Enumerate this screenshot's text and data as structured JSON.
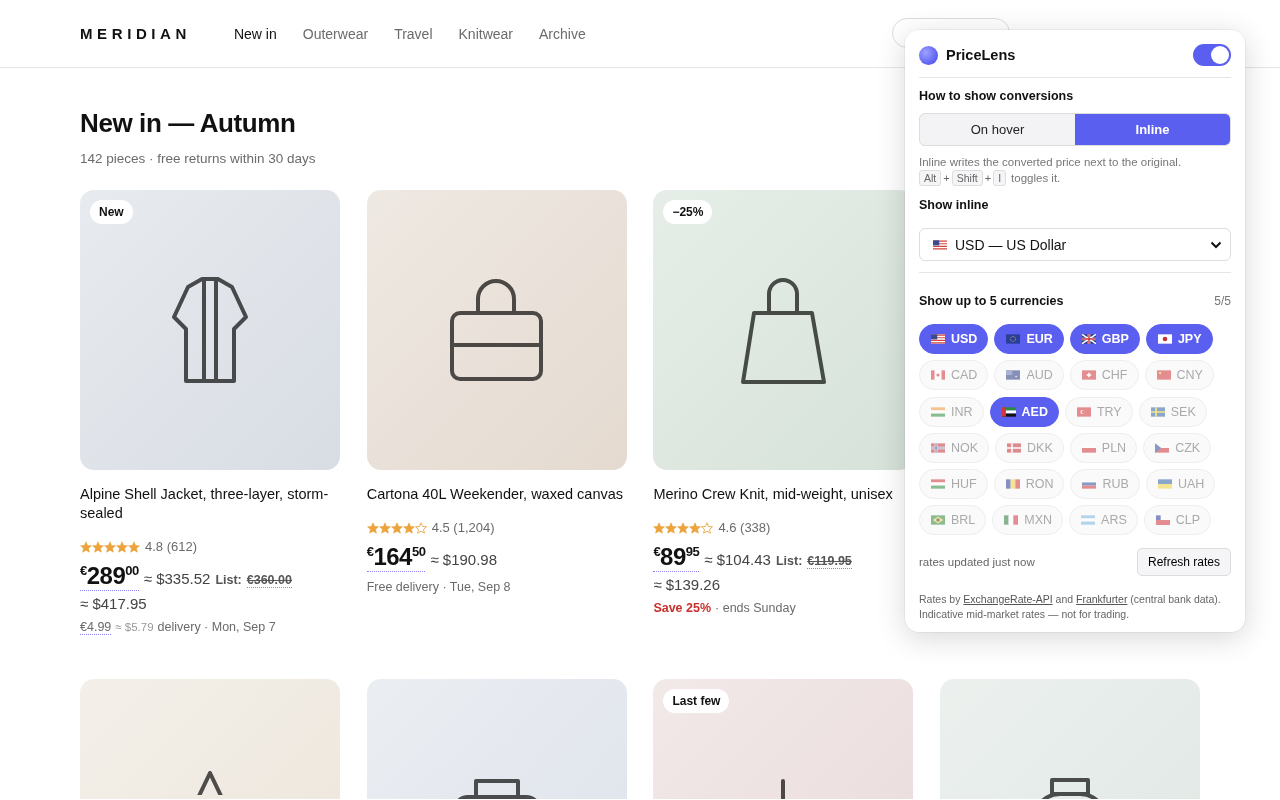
{
  "header": {
    "logo": "MERIDIAN",
    "nav": [
      {
        "label": "New in",
        "selected": true
      },
      {
        "label": "Outerwear",
        "selected": false
      },
      {
        "label": "Travel",
        "selected": false
      },
      {
        "label": "Knitwear",
        "selected": false
      },
      {
        "label": "Archive",
        "selected": false
      }
    ]
  },
  "page": {
    "title": "New in — Autumn",
    "subtitle": "142 pieces · free returns within 30 days"
  },
  "rows": [
    {
      "products": [
        {
          "badge": "New",
          "image": {
            "kind": "jacket",
            "color": "#d8dde4"
          },
          "name": "Alpine Shell Jacket, three-layer, storm-sealed",
          "stars": 5,
          "rating": "4.8 (612)",
          "price": "$^{€}$289$^{00}$",
          "converted": "≈ $335.52",
          "list_label": "List:",
          "list_price": "€360.00",
          "list_converted": "≈ $417.95",
          "note": [
            {
              "kind": "price",
              "text": "€4.99"
            },
            {
              "kind": "converted",
              "text": "≈ $5.79"
            },
            {
              "kind": "text",
              "text": "delivery · Mon, Sep 7"
            }
          ]
        },
        {
          "image": {
            "kind": "briefcase",
            "color": "#e4dad0"
          },
          "name": "Cartona 40L Weekender, waxed canvas",
          "stars": 4,
          "rating": "4.5 (1,204)",
          "price": "$^{€}$164$^{50}$",
          "converted": "≈ $190.98",
          "note": [
            {
              "kind": "text",
              "text": "Free delivery · Tue, Sep 8"
            }
          ]
        },
        {
          "badge": "−25%",
          "image": {
            "kind": "tote",
            "color": "#d6e2d9"
          },
          "name": "Merino Crew Knit, mid-weight, unisex",
          "stars": 4,
          "rating": "4.6 (338)",
          "price": "$^{€}$89$^{95}$",
          "converted": "≈ $104.43",
          "list_label": "List:",
          "list_price": "€119.95",
          "list_converted": "≈ $139.26",
          "note": [
            {
              "kind": "alert",
              "text": "Save 25%"
            },
            {
              "kind": "text",
              "text": "· ends Sunday"
            }
          ]
        }
      ]
    },
    {
      "products": [
        {
          "image": {
            "kind": "tent",
            "color": "#ece5da"
          }
        },
        {
          "image": {
            "kind": "bag",
            "color": "#dde2ea"
          }
        },
        {
          "badge": "Last few",
          "image": {
            "kind": "pole",
            "color": "#e9dada"
          }
        },
        {
          "image": {
            "kind": "jar",
            "color": "#dfe7e3"
          }
        }
      ]
    }
  ],
  "extension": {
    "name": "PriceLens",
    "enabled": true,
    "mode_label": "How to show conversions",
    "modes": [
      {
        "label": "On hover",
        "selected": false
      },
      {
        "label": "Inline",
        "selected": true
      }
    ],
    "help": "Inline writes the converted price next to the original.",
    "shortcut": [
      {
        "kind": "key",
        "text": "Alt"
      },
      {
        "kind": "plus",
        "text": "+"
      },
      {
        "kind": "key",
        "text": "Shift"
      },
      {
        "kind": "plus",
        "text": "+"
      },
      {
        "kind": "key",
        "text": "I"
      }
    ],
    "shortcut_note": "toggles it.",
    "inline_label": "Show inline",
    "inline_currency": {
      "kind": "us",
      "value": "USD — US Dollar"
    },
    "currencies_label": "Show up to 5 currencies",
    "currencies_count": "5/5",
    "currencies": [
      {
        "code": "USD",
        "kind": "us",
        "selected": true
      },
      {
        "code": "EUR",
        "kind": "eu",
        "selected": true
      },
      {
        "code": "GBP",
        "kind": "gb",
        "selected": true
      },
      {
        "code": "JPY",
        "kind": "jp",
        "selected": true
      },
      {
        "code": "CAD",
        "kind": "ca",
        "selected": false
      },
      {
        "code": "AUD",
        "kind": "au",
        "selected": false
      },
      {
        "code": "CHF",
        "kind": "ch",
        "selected": false
      },
      {
        "code": "CNY",
        "kind": "cn",
        "selected": false
      },
      {
        "code": "INR",
        "kind": "in",
        "selected": false
      },
      {
        "code": "AED",
        "kind": "ae",
        "selected": true
      },
      {
        "code": "TRY",
        "kind": "tr",
        "selected": false
      },
      {
        "code": "SEK",
        "kind": "se",
        "selected": false
      },
      {
        "code": "NOK",
        "kind": "no",
        "selected": false
      },
      {
        "code": "DKK",
        "kind": "dk",
        "selected": false
      },
      {
        "code": "PLN",
        "kind": "pl",
        "selected": false
      },
      {
        "code": "CZK",
        "kind": "cz",
        "selected": false
      },
      {
        "code": "HUF",
        "kind": "hu",
        "selected": false
      },
      {
        "code": "RON",
        "kind": "ro",
        "selected": false
      },
      {
        "code": "RUB",
        "kind": "ru",
        "selected": false
      },
      {
        "code": "UAH",
        "kind": "ua",
        "selected": false
      },
      {
        "code": "BRL",
        "kind": "br",
        "selected": false
      },
      {
        "code": "MXN",
        "kind": "mx",
        "selected": false
      },
      {
        "code": "ARS",
        "kind": "ar",
        "selected": false
      },
      {
        "code": "CLP",
        "kind": "cl",
        "selected": false
      }
    ],
    "status": "rates updated just now",
    "refresh": "Refresh rates",
    "credits": [
      {
        "kind": "text",
        "text": "Rates by "
      },
      {
        "kind": "link",
        "text": "ExchangeRate-API"
      },
      {
        "kind": "text",
        "text": " and "
      },
      {
        "kind": "link",
        "text": "Frankfurter"
      },
      {
        "kind": "text",
        "text": " (central bank data). Indicative mid-market rates — not for trading."
      }
    ]
  }
}
